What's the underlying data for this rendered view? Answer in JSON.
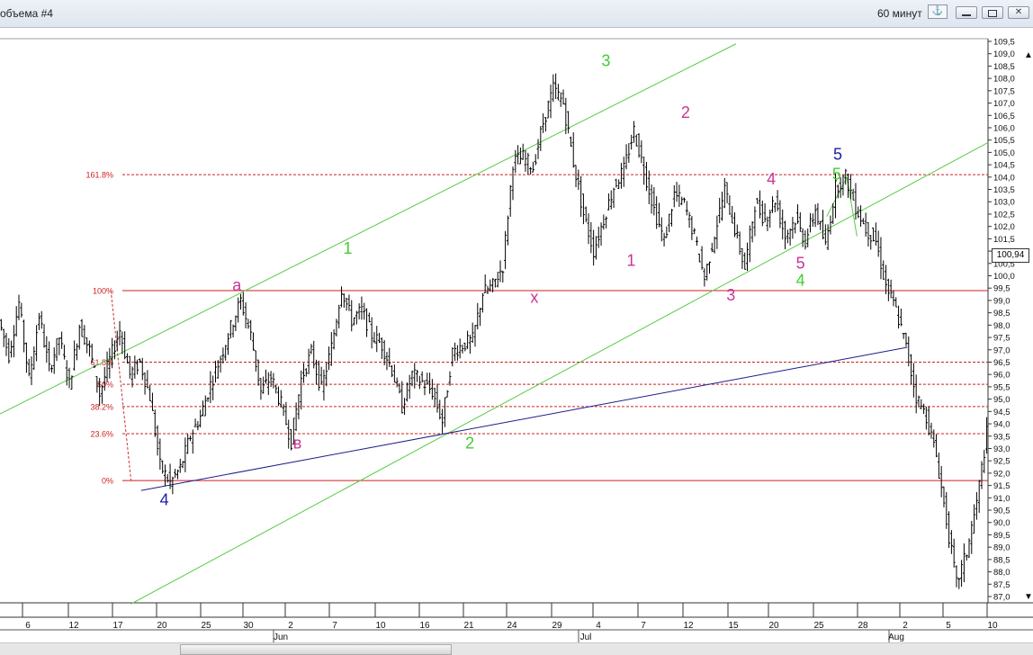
{
  "window": {
    "title": "объема #4",
    "timeframe": "60 минут",
    "pin_icon": "anchor-icon",
    "buttons": [
      "minimize-icon",
      "restore-icon",
      "close-icon"
    ]
  },
  "chart_data": {
    "type": "ohlc",
    "instrument": "",
    "current_price_label": "100,94",
    "ylim": [
      87.0,
      109.5
    ],
    "y_ticks": [
      "109,5",
      "109,0",
      "108,5",
      "108,0",
      "107,5",
      "107,0",
      "106,5",
      "106,0",
      "105,5",
      "105,0",
      "104,5",
      "104,0",
      "103,5",
      "103,0",
      "102,5",
      "102,0",
      "101,5",
      "101,0",
      "100,5",
      "100,0",
      "99,5",
      "99,0",
      "98,5",
      "98,0",
      "97,5",
      "97,0",
      "96,5",
      "96,0",
      "95,5",
      "95,0",
      "94,5",
      "94,0",
      "93,5",
      "93,0",
      "92,5",
      "92,0",
      "91,5",
      "91,0",
      "90,5",
      "90,0",
      "89,5",
      "89,0",
      "88,5",
      "88,0",
      "87,5",
      "87,0"
    ],
    "x_ticks": [
      "6",
      "12",
      "17",
      "20",
      "25",
      "30",
      "2",
      "7",
      "10",
      "16",
      "21",
      "24",
      "29",
      "4",
      "7",
      "12",
      "15",
      "20",
      "25",
      "28",
      "2",
      "5",
      "10"
    ],
    "months": [
      "Jun",
      "Jul",
      "Aug"
    ],
    "price_path": [
      [
        0,
        98.2
      ],
      [
        1,
        96.8
      ],
      [
        2,
        98.9
      ],
      [
        3,
        95.8
      ],
      [
        4,
        98.4
      ],
      [
        5,
        96.2
      ],
      [
        6,
        97.5
      ],
      [
        7,
        95.6
      ],
      [
        8,
        98.0
      ],
      [
        9,
        97.0
      ],
      [
        10,
        95.2
      ],
      [
        11,
        96.6
      ],
      [
        12,
        97.8
      ],
      [
        13,
        96.0
      ],
      [
        14,
        96.5
      ],
      [
        15,
        95.1
      ],
      [
        16,
        92.3
      ],
      [
        17,
        91.6
      ],
      [
        18,
        92.2
      ],
      [
        19,
        93.5
      ],
      [
        20,
        94.3
      ],
      [
        21,
        95.6
      ],
      [
        22,
        96.7
      ],
      [
        23,
        97.9
      ],
      [
        24,
        99.0
      ],
      [
        25,
        97.6
      ],
      [
        26,
        95.3
      ],
      [
        27,
        95.9
      ],
      [
        28,
        94.8
      ],
      [
        29,
        93.3
      ],
      [
        30,
        95.8
      ],
      [
        31,
        96.9
      ],
      [
        32,
        95.4
      ],
      [
        33,
        97.1
      ],
      [
        34,
        99.5
      ],
      [
        35,
        98.2
      ],
      [
        36,
        98.6
      ],
      [
        37,
        97.6
      ],
      [
        38,
        97.2
      ],
      [
        39,
        96.2
      ],
      [
        40,
        94.7
      ],
      [
        41,
        96.0
      ],
      [
        42,
        95.7
      ],
      [
        43,
        95.3
      ],
      [
        44,
        94.1
      ],
      [
        45,
        96.9
      ],
      [
        46,
        97.2
      ],
      [
        47,
        97.4
      ],
      [
        48,
        99.3
      ],
      [
        49,
        99.6
      ],
      [
        50,
        100.4
      ],
      [
        51,
        104.6
      ],
      [
        52,
        104.8
      ],
      [
        53,
        104.4
      ],
      [
        54,
        106.2
      ],
      [
        55,
        107.6
      ],
      [
        56,
        107.0
      ],
      [
        57,
        104.6
      ],
      [
        58,
        102.5
      ],
      [
        59,
        101.0
      ],
      [
        60,
        102.3
      ],
      [
        61,
        103.6
      ],
      [
        62,
        104.3
      ],
      [
        63,
        105.9
      ],
      [
        64,
        104.3
      ],
      [
        65,
        102.7
      ],
      [
        66,
        101.4
      ],
      [
        67,
        103.3
      ],
      [
        68,
        102.9
      ],
      [
        69,
        101.6
      ],
      [
        70,
        99.9
      ],
      [
        71,
        101.7
      ],
      [
        72,
        103.5
      ],
      [
        73,
        101.9
      ],
      [
        74,
        100.3
      ],
      [
        75,
        102.9
      ],
      [
        76,
        102.3
      ],
      [
        77,
        103.1
      ],
      [
        78,
        101.6
      ],
      [
        79,
        102.3
      ],
      [
        80,
        101.4
      ],
      [
        81,
        102.7
      ],
      [
        82,
        101.2
      ],
      [
        83,
        103.6
      ],
      [
        84,
        104.0
      ],
      [
        85,
        102.8
      ],
      [
        86,
        101.9
      ],
      [
        87,
        101.4
      ],
      [
        88,
        99.6
      ],
      [
        89,
        98.6
      ],
      [
        90,
        97.1
      ],
      [
        91,
        95.1
      ],
      [
        92,
        94.3
      ],
      [
        93,
        92.7
      ],
      [
        94,
        90.1
      ],
      [
        95,
        87.5
      ],
      [
        96,
        88.8
      ],
      [
        97,
        90.8
      ],
      [
        98,
        93.6
      ]
    ],
    "horizontal_levels": [
      {
        "label": "161.8%",
        "value": 104.1,
        "style": "dashed"
      },
      {
        "label": "100%",
        "value": 99.4,
        "style": "solid"
      },
      {
        "label": "61.8%",
        "value": 96.5,
        "style": "dashed"
      },
      {
        "label": "50%",
        "value": 95.6,
        "style": "dashed"
      },
      {
        "label": "38.2%",
        "value": 94.7,
        "style": "dashed"
      },
      {
        "label": "23.6%",
        "value": 93.6,
        "style": "dashed"
      },
      {
        "label": "0%",
        "value": 91.7,
        "style": "solid"
      }
    ],
    "trend_lines": [
      {
        "color": "#55cc44",
        "from": [
          0,
          94.4
        ],
        "to": [
          73,
          109.4
        ]
      },
      {
        "color": "#55cc44",
        "from": [
          13,
          86.7
        ],
        "to": [
          98,
          105.4
        ]
      },
      {
        "color": "#1c1c8c",
        "from": [
          14,
          91.3
        ],
        "to": [
          90,
          97.1
        ]
      },
      {
        "color": "#55cc44",
        "from": [
          82,
          102.4
        ],
        "to": [
          84,
          104.0
        ]
      },
      {
        "color": "#55cc44",
        "from": [
          84,
          104.0
        ],
        "to": [
          85,
          101.6
        ]
      },
      {
        "color": "#cc3333",
        "dashed": true,
        "from": [
          11,
          99.4
        ],
        "to": [
          13,
          91.7
        ]
      }
    ],
    "wave_labels": [
      {
        "text": "1",
        "color": "#44cc33",
        "x": 34.5,
        "y": 100.9
      },
      {
        "text": "2",
        "color": "#44cc33",
        "x": 46.6,
        "y": 93.0
      },
      {
        "text": "3",
        "color": "#44cc33",
        "x": 60.1,
        "y": 108.5
      },
      {
        "text": "4",
        "color": "#44cc33",
        "x": 79.4,
        "y": 99.6
      },
      {
        "text": "5",
        "color": "#44cc33",
        "x": 83.0,
        "y": 103.9
      },
      {
        "text": "a",
        "color": "#cc3399",
        "x": 23.5,
        "y": 99.4
      },
      {
        "text": "в",
        "color": "#cc3399",
        "x": 29.5,
        "y": 93.0
      },
      {
        "text": "x",
        "color": "#cc3399",
        "x": 53.0,
        "y": 98.9
      },
      {
        "text": "1",
        "color": "#cc3399",
        "x": 62.6,
        "y": 100.4
      },
      {
        "text": "2",
        "color": "#cc3399",
        "x": 68.0,
        "y": 106.4
      },
      {
        "text": "3",
        "color": "#cc3399",
        "x": 72.5,
        "y": 99.0
      },
      {
        "text": "4",
        "color": "#cc3399",
        "x": 76.5,
        "y": 103.7
      },
      {
        "text": "5",
        "color": "#cc3399",
        "x": 79.4,
        "y": 100.3
      },
      {
        "text": "4",
        "color": "#1c1caa",
        "x": 16.3,
        "y": 90.7
      },
      {
        "text": "5",
        "color": "#1c1caa",
        "x": 83.1,
        "y": 104.7
      }
    ]
  }
}
